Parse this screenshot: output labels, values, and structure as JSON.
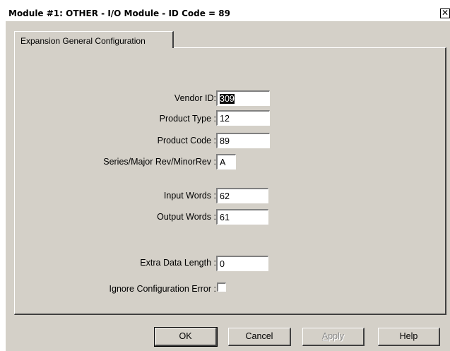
{
  "window": {
    "title": "Module #1: OTHER - I/O Module - ID Code = 89",
    "close_glyph": "✕"
  },
  "tabs": [
    {
      "label": "Expansion General Configuration"
    }
  ],
  "form": {
    "vendor_id": {
      "label": "Vendor ID:",
      "value": "309"
    },
    "product_type": {
      "label": "Product Type :",
      "value": "12"
    },
    "product_code": {
      "label": "Product Code :",
      "value": "89"
    },
    "series_rev": {
      "label": "Series/Major Rev/MinorRev :",
      "value": "A"
    },
    "input_words": {
      "label": "Input Words :",
      "value": "62"
    },
    "output_words": {
      "label": "Output Words :",
      "value": "61"
    },
    "extra_data_length": {
      "label": "Extra Data Length :",
      "value": "0"
    },
    "ignore_config_error": {
      "label": "Ignore Configuration Error :",
      "checked": false
    }
  },
  "buttons": {
    "ok": "OK",
    "cancel": "Cancel",
    "apply_first": "A",
    "apply_rest": "pply",
    "help": "Help"
  }
}
